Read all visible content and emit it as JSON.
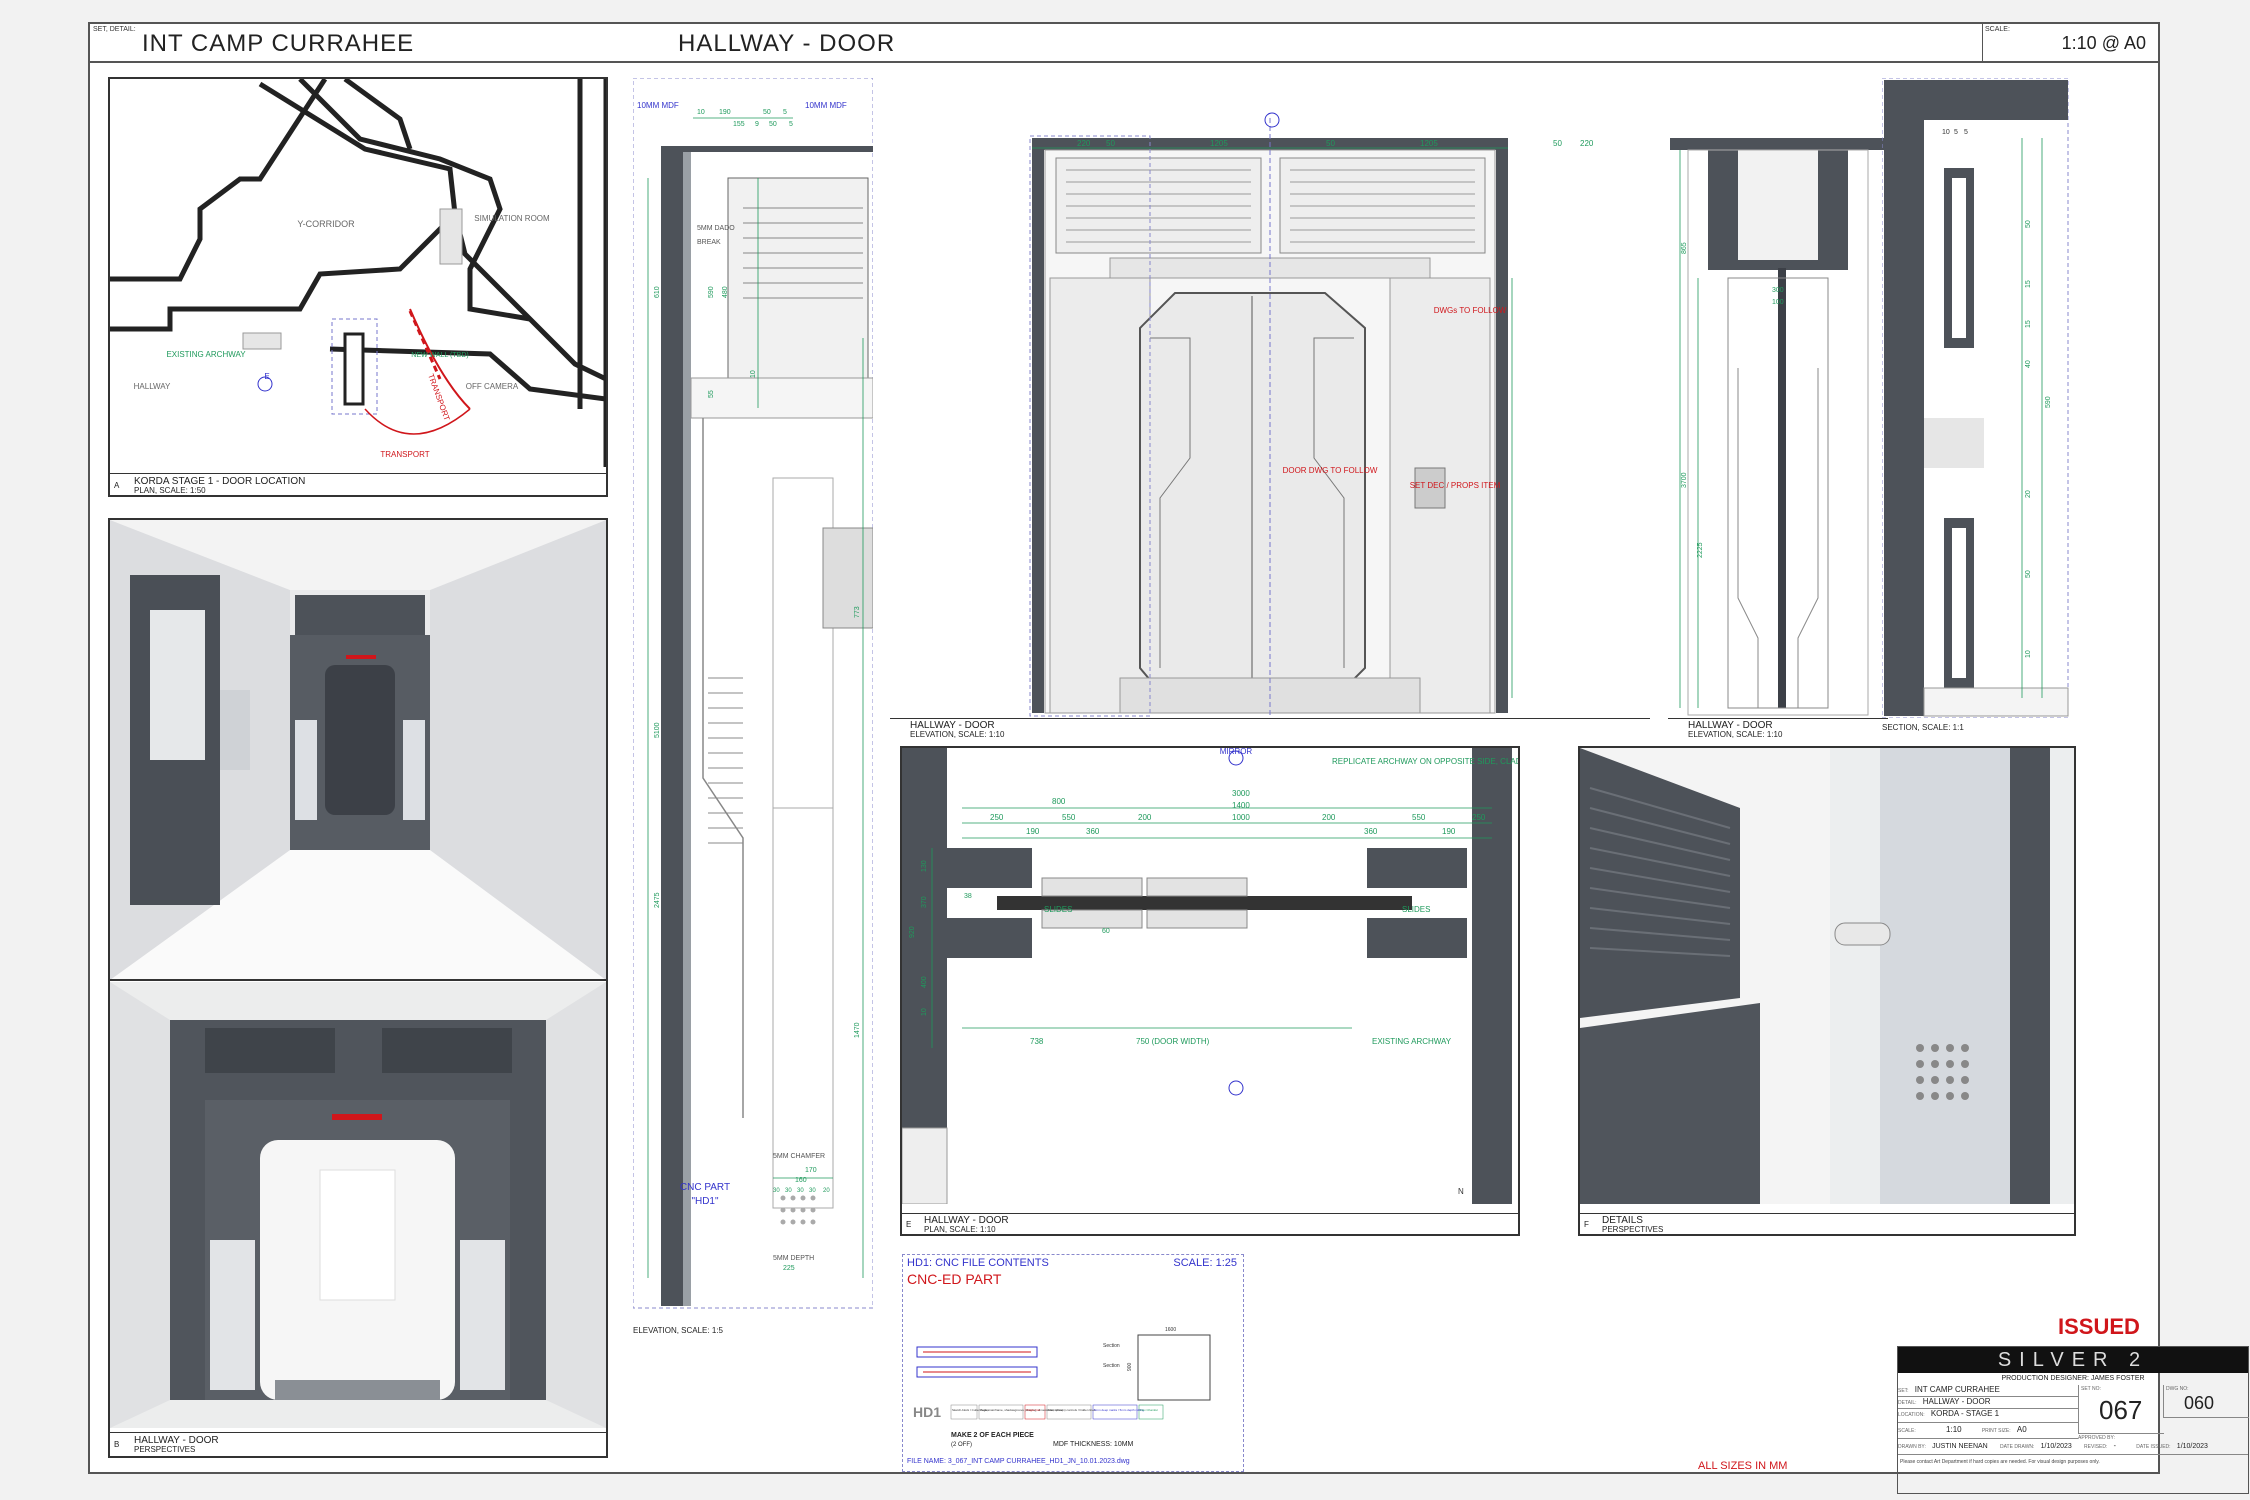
{
  "header": {
    "set_detail_label": "SET, DETAIL:",
    "set_name": "INT CAMP CURRAHEE",
    "detail_name": "HALLWAY - DOOR",
    "scale_label": "SCALE:",
    "scale": "1:10 @ A0"
  },
  "panels": {
    "a": {
      "letter": "A",
      "title": "KORDA STAGE 1 - DOOR LOCATION",
      "sub": "PLAN, SCALE: 1:50",
      "labels": {
        "y_corridor": "Y-CORRIDOR",
        "simulation_room": "SIMULATION ROOM",
        "existing_archway": "EXISTING ARCHWAY",
        "new_wall": "NEW WALL (TBD)",
        "transport_1": "TRANSPORT",
        "off_camera": "OFF CAMERA",
        "hallway": "HALLWAY",
        "transport_2": "TRANSPORT",
        "elev_mark": "E"
      }
    },
    "b": {
      "letter": "B",
      "title": "HALLWAY - DOOR",
      "sub": "PERSPECTIVES"
    },
    "side_elev": {
      "title": "ELEVATION, SCALE: 1:5",
      "mdf_left": "10MM MDF",
      "mdf_right": "10MM MDF",
      "dims_top": [
        "10",
        "190",
        "155",
        "9",
        "50",
        "5",
        "50",
        "5"
      ],
      "dado_note": "5MM DADO",
      "break_note": "BREAK",
      "dims_v": [
        "610",
        "590",
        "480",
        "5100",
        "2475",
        "1470",
        "773",
        "55",
        "10",
        "225"
      ],
      "cnc_part": "CNC PART",
      "cnc_code": "\"HD1\"",
      "chamfer_note": "5MM CHAMFER",
      "depth_note": "5MM DEPTH",
      "dims_small": [
        "170",
        "160",
        "30",
        "30",
        "30",
        "30",
        "20"
      ]
    },
    "elev": {
      "letter": "",
      "title": "HALLWAY - DOOR",
      "sub": "ELEVATION, SCALE: 1:10",
      "dims": [
        "220",
        "50",
        "1205",
        "50",
        "1205",
        "50",
        "220"
      ],
      "notes": {
        "dwgs": "DWGs TO FOLLOW",
        "door": "DOOR DWG TO FOLLOW",
        "set_dec": "SET DEC / PROPS ITEM"
      }
    },
    "side_view": {
      "title": "HALLWAY - DOOR",
      "sub": "ELEVATION, SCALE: 1:10",
      "dims": [
        "865",
        "3700",
        "2225",
        "300",
        "100"
      ]
    },
    "section": {
      "title": "SECTION, SCALE: 1:1",
      "dims": [
        "10",
        "5",
        "5",
        "50",
        "15",
        "15",
        "40",
        "590",
        "20",
        "50",
        "10"
      ]
    },
    "plan": {
      "letter": "E",
      "title": "HALLWAY - DOOR",
      "sub": "PLAN, SCALE: 1:10",
      "mirror": "MIRROR",
      "replicate_note": "REPLICATE ARCHWAY ON OPPOSITE SIDE, CLADDING PER ELEVATION",
      "dims_top": [
        "800",
        "3000",
        "1400",
        "250",
        "190",
        "550",
        "360",
        "200",
        "1000",
        "200",
        "360",
        "550",
        "190",
        "250"
      ],
      "slides_left": "SLIDES",
      "slides_right": "SLIDES",
      "dims_left": [
        "130",
        "370",
        "920",
        "400",
        "10",
        "38",
        "60"
      ],
      "dims_bottom": [
        "738",
        "750 (DOOR WIDTH)"
      ],
      "existing_archway": "EXISTING ARCHWAY",
      "north": "N"
    },
    "f": {
      "letter": "F",
      "title": "DETAILS",
      "sub": "PERSPECTIVES"
    }
  },
  "cnc": {
    "title": "HD1: CNC FILE CONTENTS",
    "scale": "SCALE: 1:25",
    "part": "CNC-ED PART",
    "code": "HD1",
    "make_note": "MAKE 2 OF EACH PIECE",
    "make_sub": "(2 OFF)",
    "mdf": "MDF THICKNESS: 10MM",
    "legend": [
      "Sketch-block / Cutter codes:",
      "Pegs, mainframe, shadowgroove (drawing, dimensions, notes)",
      "Vrtigle Cut",
      "Mark (dimen) controls / hidden lines",
      "5mm deep marks / 5mm depth milling",
      "Flex Chamfer"
    ],
    "section_a": "Section",
    "section_b": "Section",
    "dim_w": "1600",
    "dim_h": "900",
    "filename": "FILE NAME: 3_067_INT CAMP CURRAHEE_HD1_JN_10.01.2023.dwg"
  },
  "titleblock": {
    "issued": "ISSUED",
    "logo": "SILVER 2",
    "designer": "PRODUCTION DESIGNER: JAMES FOSTER",
    "set_label": "SET:",
    "set": "INT CAMP CURRAHEE",
    "detail_label": "DETAIL:",
    "detail": "HALLWAY - DOOR",
    "location_label": "LOCATION:",
    "location": "KORDA - STAGE 1",
    "set_no_label": "SET NO:",
    "set_no": "067",
    "dwg_no_label": "DWG NO:",
    "dwg_no": "060",
    "scale_label": "SCALE:",
    "scale": "1:10",
    "print_label": "PRINT SIZE:",
    "print": "A0",
    "approved_label": "APPROVED BY:",
    "drawn_label": "DRAWN BY:",
    "drawn": "JUSTIN NEENAN",
    "date_drawn_label": "DATE DRAWN:",
    "date_drawn": "1/10/2023",
    "revised_label": "REVISED:",
    "revised": "-",
    "date_issued_label": "DATE ISSUED:",
    "date_issued": "1/10/2023",
    "footnote": "Please contact Art Department if hard copies are needed. For visual design purposes only."
  },
  "footer_note": "ALL SIZES IN MM",
  "colors": {
    "red": "#d0161b",
    "green": "#1f9a5c",
    "blue": "#3333cc",
    "dark": "#4d5259",
    "mid": "#9aa0a6"
  }
}
